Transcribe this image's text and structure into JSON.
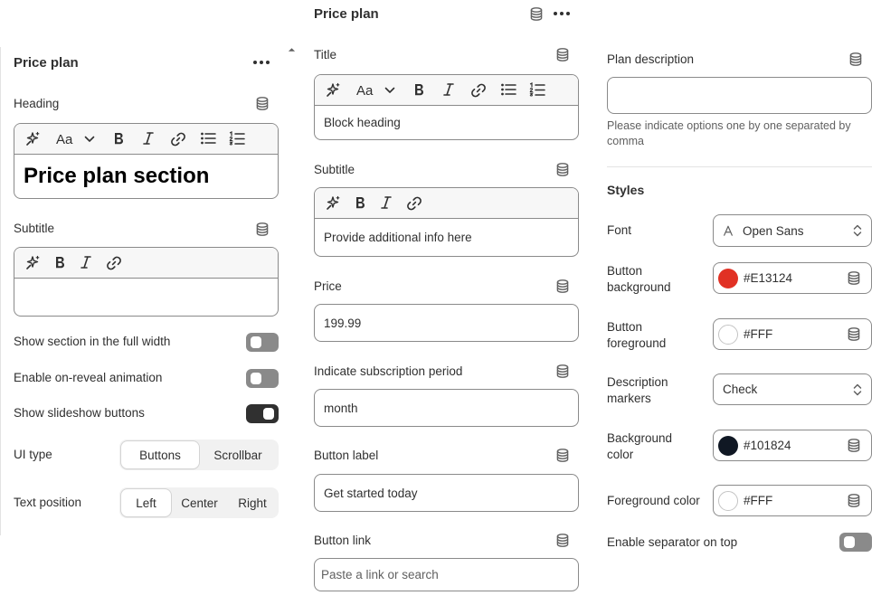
{
  "left_panel": {
    "title": "Price plan",
    "heading": {
      "label": "Heading",
      "value": "Price plan section"
    },
    "subtitle": {
      "label": "Subtitle",
      "value": ""
    },
    "toggles": [
      {
        "label": "Show section in the full width",
        "on": false
      },
      {
        "label": "Enable on-reveal animation",
        "on": false
      },
      {
        "label": "Show slideshow buttons",
        "on": true
      }
    ],
    "ui_type": {
      "label": "UI type",
      "options": [
        "Buttons",
        "Scrollbar"
      ],
      "selected": "Buttons"
    },
    "text_position": {
      "label": "Text position",
      "options": [
        "Left",
        "Center",
        "Right"
      ],
      "selected": "Left"
    }
  },
  "middle_panel": {
    "title": "Price plan",
    "title_field": {
      "label": "Title",
      "value": "Block heading"
    },
    "subtitle_field": {
      "label": "Subtitle",
      "value": "Provide additional info here"
    },
    "price": {
      "label": "Price",
      "value": "199.99"
    },
    "period": {
      "label": "Indicate subscription period",
      "value": "month"
    },
    "button_label": {
      "label": "Button label",
      "value": "Get started today"
    },
    "button_link": {
      "label": "Button link",
      "placeholder": "Paste a link or search"
    }
  },
  "right_panel": {
    "plan_description": {
      "label": "Plan description",
      "value": "",
      "hint": "Please indicate options one by one separated by comma"
    },
    "styles_heading": "Styles",
    "font": {
      "label": "Font",
      "value": "Open Sans"
    },
    "button_background": {
      "label_line1": "Button",
      "label_line2": "background",
      "value": "#E13124",
      "swatch": "#E13124"
    },
    "button_foreground": {
      "label_line1": "Button",
      "label_line2": "foreground",
      "value": "#FFF",
      "swatch": "#FFFFFF"
    },
    "description_markers": {
      "label_line1": "Description",
      "label_line2": "markers",
      "value": "Check"
    },
    "background_color": {
      "label_line1": "Background",
      "label_line2": "color",
      "value": "#101824",
      "swatch": "#101824"
    },
    "foreground_color": {
      "label": "Foreground color",
      "value": "#FFF",
      "swatch": "#FFFFFF"
    },
    "separator_toggle": {
      "label": "Enable separator on top",
      "on": false
    }
  },
  "icons": [
    "database-icon",
    "more-horizontal-icon",
    "magic-icon",
    "text-size-icon",
    "chevron-down-icon",
    "bold-icon",
    "italic-icon",
    "link-icon",
    "bullet-list-icon",
    "numbered-list-icon",
    "font-icon",
    "select-chevron-icon",
    "scroll-up-icon"
  ]
}
